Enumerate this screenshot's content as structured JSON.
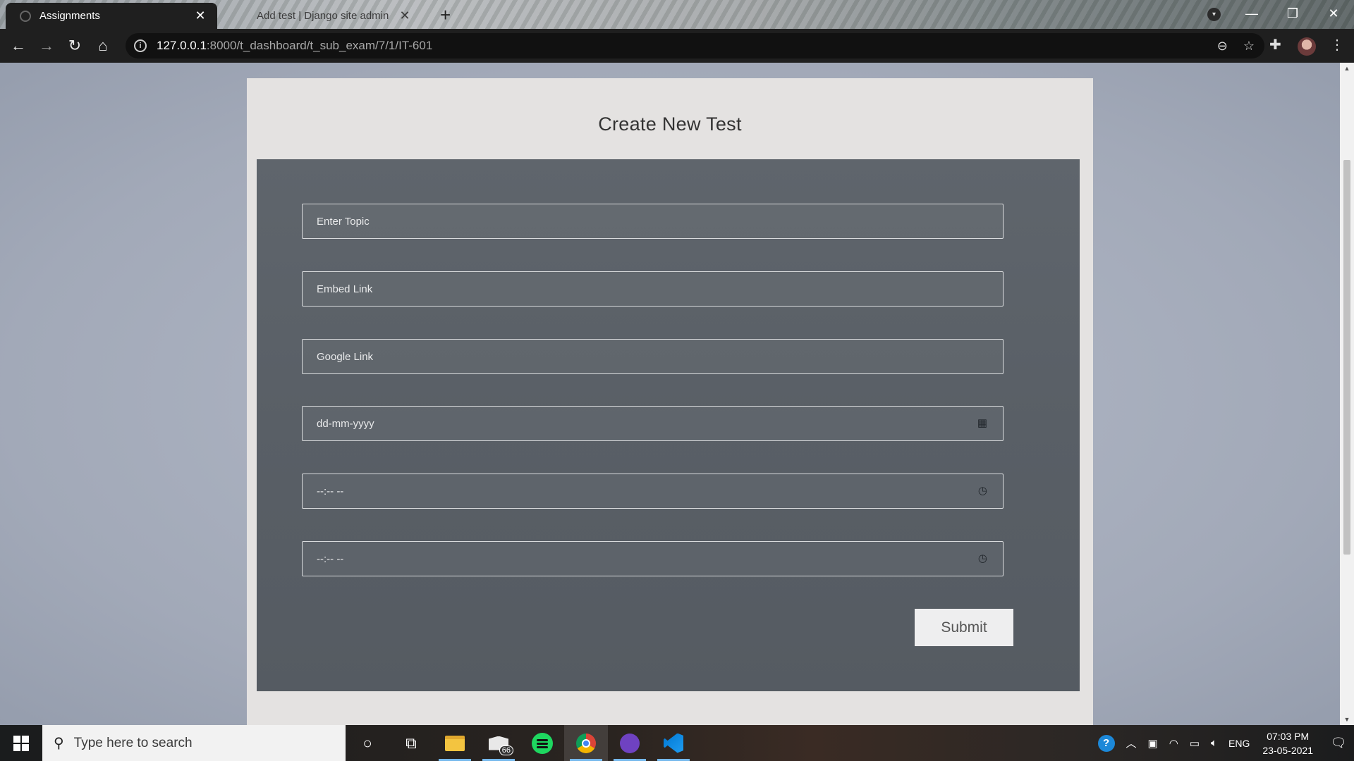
{
  "browser": {
    "tabs": [
      {
        "title": "Assignments",
        "active": true
      },
      {
        "title": "Add test | Django site admin",
        "active": false
      }
    ],
    "url_host": "127.0.0.1",
    "url_path": ":8000/t_dashboard/t_sub_exam/7/1/IT-601"
  },
  "page": {
    "title": "Create New Test",
    "fields": {
      "topic_placeholder": "Enter Topic",
      "embed_placeholder": "Embed Link",
      "google_placeholder": "Google Link",
      "date_placeholder": "dd-mm-yyyy",
      "start_time_placeholder": "--:-- --",
      "end_time_placeholder": "--:-- --"
    },
    "submit_label": "Submit"
  },
  "taskbar": {
    "search_placeholder": "Type here to search",
    "mail_badge": "66",
    "language": "ENG",
    "time": "07:03 PM",
    "date": "23-05-2021"
  },
  "colors": {
    "form_panel": "#5a6067",
    "card": "#e4e2e1",
    "page_background": "#a7afbf"
  }
}
